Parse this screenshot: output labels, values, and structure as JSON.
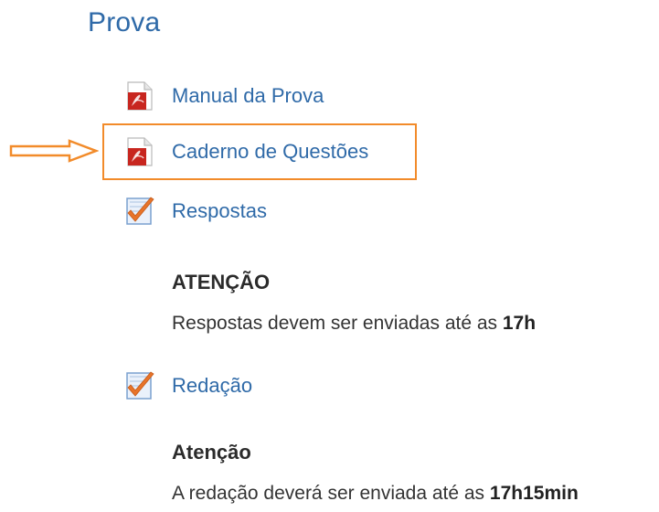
{
  "section": {
    "title": "Prova"
  },
  "items": [
    {
      "label": "Manual da Prova",
      "icon": "pdf-icon"
    },
    {
      "label": "Caderno de Questões",
      "icon": "pdf-icon"
    },
    {
      "label": "Respostas",
      "icon": "assignment-check-icon"
    },
    {
      "label": "Redação",
      "icon": "assignment-check-icon"
    }
  ],
  "notices": {
    "respostas": {
      "heading": "ATENÇÃO",
      "text": "Respostas devem ser enviadas até as ",
      "time": "17h"
    },
    "redacao": {
      "heading": "Atenção",
      "text": "A redação deverá ser enviada até as ",
      "time": "17h15min"
    }
  },
  "colors": {
    "link": "#2f6aa8",
    "highlight": "#f28b2a",
    "pdf_red": "#c8261f",
    "check_orange": "#e8742a"
  }
}
